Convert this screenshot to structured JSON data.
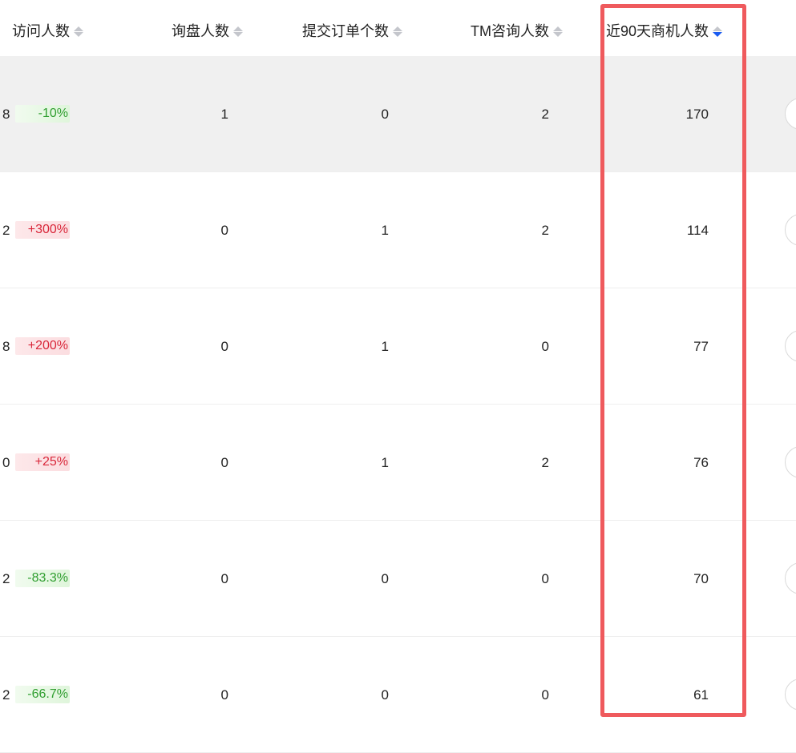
{
  "columns": {
    "visits": "访问人数",
    "inquiries": "询盘人数",
    "orders": "提交订单个数",
    "tm_consult": "TM咨询人数",
    "opportunities_90d": "近90天商机人数"
  },
  "sort": {
    "active_column": "opportunities_90d",
    "direction": "descending",
    "active_color": "#1a5bf0"
  },
  "rows": [
    {
      "visits_partial": "8",
      "change": "-10%",
      "change_trend": "down",
      "inquiries": "1",
      "orders": "0",
      "tm_consult": "2",
      "opportunities_90d": "170"
    },
    {
      "visits_partial": "2",
      "change": "+300%",
      "change_trend": "up",
      "inquiries": "0",
      "orders": "1",
      "tm_consult": "2",
      "opportunities_90d": "114"
    },
    {
      "visits_partial": "8",
      "change": "+200%",
      "change_trend": "up",
      "inquiries": "0",
      "orders": "1",
      "tm_consult": "0",
      "opportunities_90d": "77"
    },
    {
      "visits_partial": "0",
      "change": "+25%",
      "change_trend": "up",
      "inquiries": "0",
      "orders": "1",
      "tm_consult": "2",
      "opportunities_90d": "76"
    },
    {
      "visits_partial": "2",
      "change": "-83.3%",
      "change_trend": "down",
      "inquiries": "0",
      "orders": "0",
      "tm_consult": "0",
      "opportunities_90d": "70"
    },
    {
      "visits_partial": "2",
      "change": "-66.7%",
      "change_trend": "down",
      "inquiries": "0",
      "orders": "0",
      "tm_consult": "0",
      "opportunities_90d": "61"
    }
  ],
  "colors": {
    "highlight_outline": "#ef5a5d",
    "trend_up": "#d9273a",
    "trend_down": "#2f9e2f",
    "hover_row_bg": "#f0f0f0"
  }
}
